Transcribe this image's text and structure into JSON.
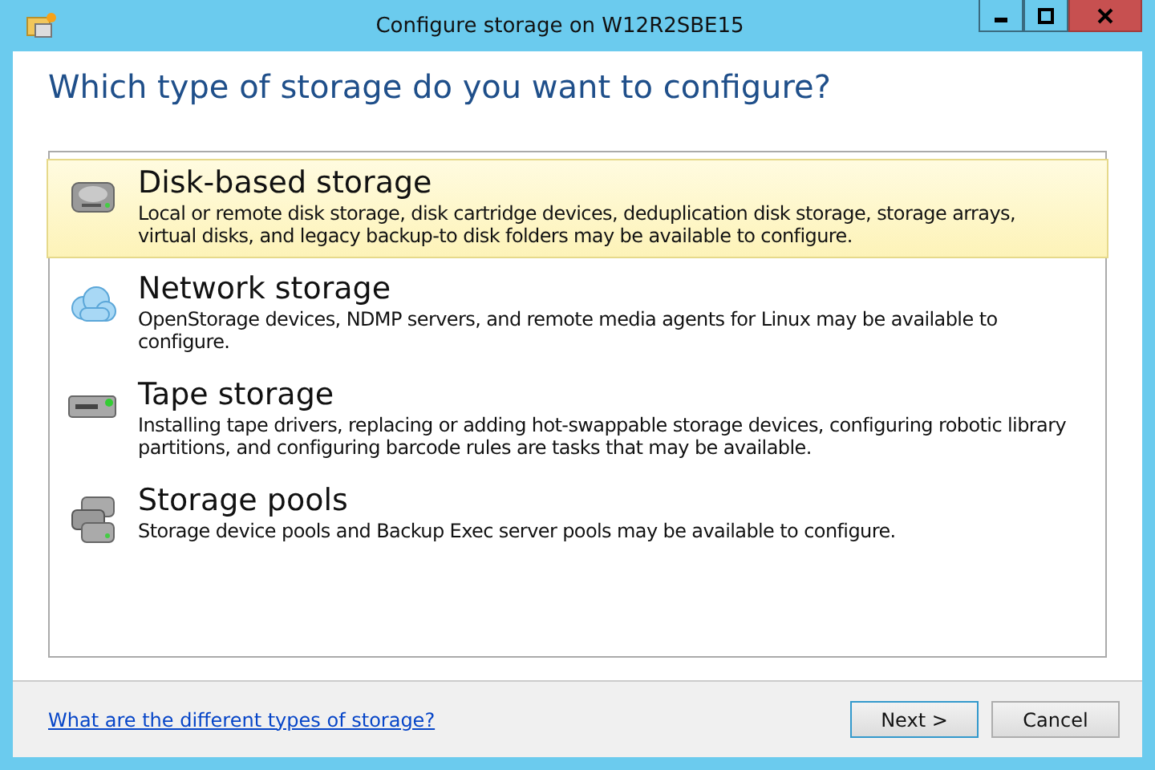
{
  "window": {
    "title": "Configure storage on W12R2SBE15"
  },
  "heading": "Which type of storage do you want to configure?",
  "storage_types": [
    {
      "kind": "disk",
      "title": "Disk-based storage",
      "description": "Local or remote disk storage, disk cartridge devices, deduplication disk storage, storage arrays, virtual disks, and legacy backup-to disk folders may be available to configure.",
      "selected": true
    },
    {
      "kind": "network",
      "title": "Network storage",
      "description": "OpenStorage devices, NDMP servers, and remote media agents for Linux may be available to configure.",
      "selected": false
    },
    {
      "kind": "tape",
      "title": "Tape storage",
      "description": "Installing tape drivers, replacing or adding hot-swappable storage devices, configuring robotic library partitions, and configuring barcode rules are tasks that may be available.",
      "selected": false
    },
    {
      "kind": "pools",
      "title": "Storage pools",
      "description": "Storage device pools and Backup Exec server pools may be available to configure.",
      "selected": false
    }
  ],
  "footer": {
    "help_link": "What are the different types of storage?",
    "buttons": [
      {
        "label": "Next >",
        "default": true
      },
      {
        "label": "Cancel",
        "default": false
      }
    ]
  }
}
